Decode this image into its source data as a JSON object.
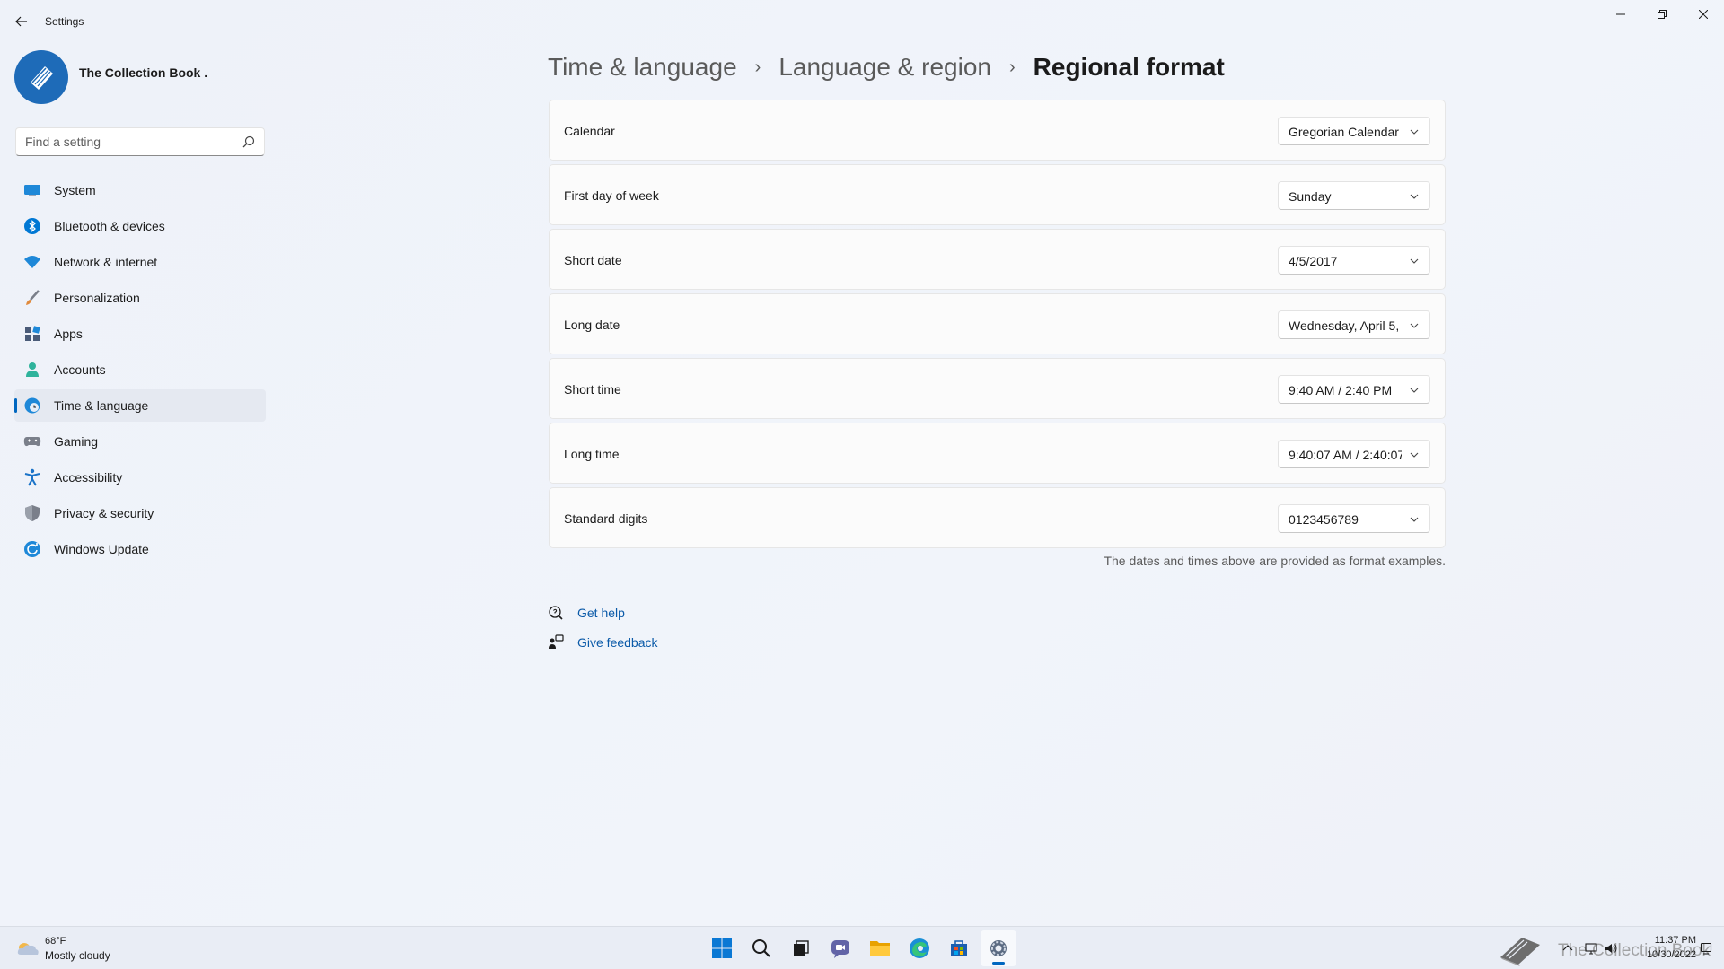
{
  "window": {
    "title": "Settings"
  },
  "profile": {
    "name": "The Collection Book ."
  },
  "search": {
    "placeholder": "Find a setting",
    "value": ""
  },
  "sidebar": {
    "items": [
      {
        "label": "System",
        "icon": "monitor-icon",
        "color": "#1e88d8"
      },
      {
        "label": "Bluetooth & devices",
        "icon": "bluetooth-icon",
        "color": "#0078d4"
      },
      {
        "label": "Network & internet",
        "icon": "wifi-icon",
        "color": "#1e88d8"
      },
      {
        "label": "Personalization",
        "icon": "brush-icon",
        "color": "#e08a3c"
      },
      {
        "label": "Apps",
        "icon": "apps-icon",
        "color": "#4a5b78"
      },
      {
        "label": "Accounts",
        "icon": "person-icon",
        "color": "#2fb39c"
      },
      {
        "label": "Time & language",
        "icon": "globe-clock-icon",
        "color": "#1e88d8",
        "active": true
      },
      {
        "label": "Gaming",
        "icon": "gamepad-icon",
        "color": "#7a7f8a"
      },
      {
        "label": "Accessibility",
        "icon": "accessibility-icon",
        "color": "#1a73c8"
      },
      {
        "label": "Privacy & security",
        "icon": "shield-icon",
        "color": "#7a7f8a"
      },
      {
        "label": "Windows Update",
        "icon": "update-icon",
        "color": "#1e88d8"
      }
    ]
  },
  "breadcrumb": {
    "level1": "Time & language",
    "level2": "Language & region",
    "current": "Regional format",
    "separator": "›"
  },
  "settings": [
    {
      "label": "Calendar",
      "value": "Gregorian Calendar"
    },
    {
      "label": "First day of week",
      "value": "Sunday"
    },
    {
      "label": "Short date",
      "value": "4/5/2017"
    },
    {
      "label": "Long date",
      "value": "Wednesday, April 5,"
    },
    {
      "label": "Short time",
      "value": "9:40 AM / 2:40 PM"
    },
    {
      "label": "Long time",
      "value": "9:40:07 AM / 2:40:07"
    },
    {
      "label": "Standard digits",
      "value": "0123456789"
    }
  ],
  "note": "The dates and times above are provided as format examples.",
  "help": {
    "get_help": "Get help",
    "give_feedback": "Give feedback"
  },
  "taskbar": {
    "weather_temp": "68°F",
    "weather_desc": "Mostly cloudy",
    "apps": [
      "start-icon",
      "search-icon",
      "task-view-icon",
      "chat-icon",
      "file-explorer-icon",
      "edge-icon",
      "store-icon",
      "settings-icon"
    ],
    "watermark": "The Collection Book",
    "time": "11:37 PM",
    "date": "10/30/2022"
  },
  "colors": {
    "accent": "#0067c0",
    "link": "#0a5aa8"
  }
}
